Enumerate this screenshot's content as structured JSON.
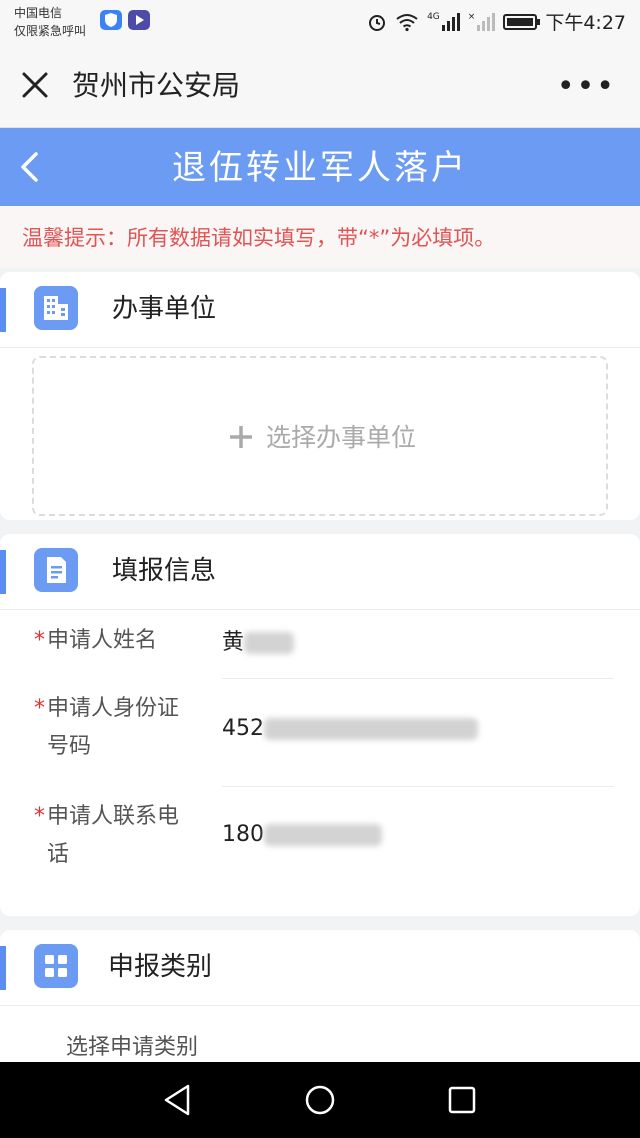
{
  "status_bar": {
    "carrier_line1": "中国电信",
    "carrier_line2": "仅限紧急呼叫",
    "icons": [
      "shield-app-icon",
      "video-app-icon",
      "alarm-icon",
      "wifi-icon",
      "signal-4g-icon",
      "signal-off-icon",
      "battery-icon"
    ],
    "network": "4G",
    "time": "下午4:27"
  },
  "title_bar": {
    "title": "贺州市公安局",
    "more": "•••"
  },
  "nav": {
    "title": "退伍转业军人落户"
  },
  "notice": {
    "text": "温馨提示：所有数据请如实填写，带“*”为必填项。"
  },
  "sections": {
    "unit": {
      "title": "办事单位",
      "pick_label": "选择办事单位",
      "icon": "building-icon"
    },
    "info": {
      "title": "填报信息",
      "icon": "document-icon",
      "fields": [
        {
          "required": "*",
          "label_line1": "申请人姓名",
          "label_line2": "",
          "value_prefix": "黄"
        },
        {
          "required": "*",
          "label_line1": "申请人身份证",
          "label_line2": "号码",
          "value_prefix": "452"
        },
        {
          "required": "*",
          "label_line1": "申请人联系电",
          "label_line2": "话",
          "value_prefix": "180"
        }
      ]
    },
    "category": {
      "title": "申报类别",
      "icon": "grid-icon",
      "select_label": "选择申请类别"
    }
  },
  "colors": {
    "primary": "#6b9bf2",
    "accent": "#5b8ef0",
    "warning_text": "#e25353",
    "required_star": "#d33333"
  }
}
